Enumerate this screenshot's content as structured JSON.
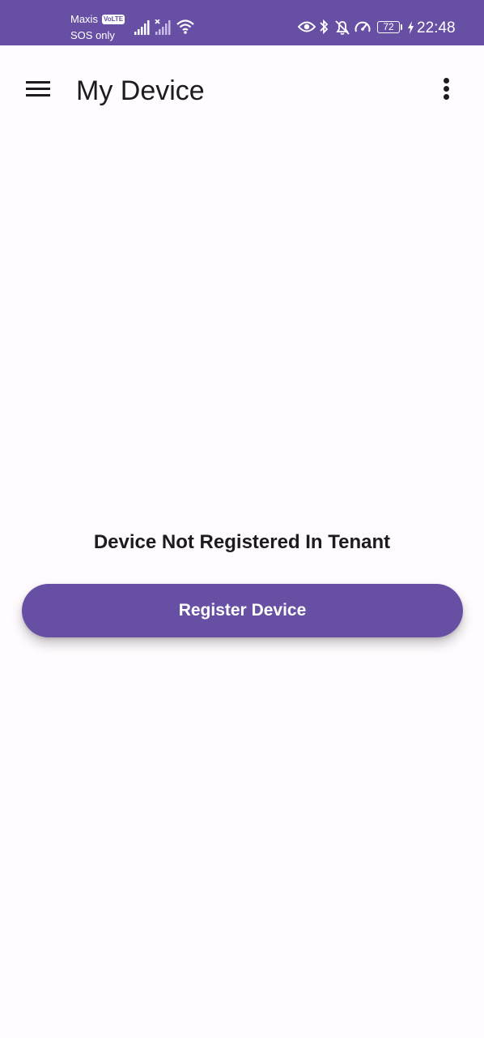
{
  "status_bar": {
    "carrier_name": "Maxis",
    "carrier_badge": "VoLTE",
    "carrier_status": "SOS only",
    "battery_level": "72",
    "time": "22:48",
    "icons": [
      "signal-icon",
      "signal-no-service-icon",
      "wifi-icon",
      "eye-icon",
      "bluetooth-icon",
      "bell-off-icon",
      "speed-icon",
      "battery-icon",
      "charging-bolt-icon"
    ]
  },
  "app_bar": {
    "title": "My Device",
    "menu_icon": "hamburger-menu-icon",
    "overflow_icon": "more-vert-icon"
  },
  "main": {
    "message": "Device Not Registered In Tenant",
    "register_button_label": "Register Device"
  },
  "colors": {
    "primary": "#6750a4",
    "background": "#fffbfe",
    "on_surface": "#1c1b1f"
  }
}
